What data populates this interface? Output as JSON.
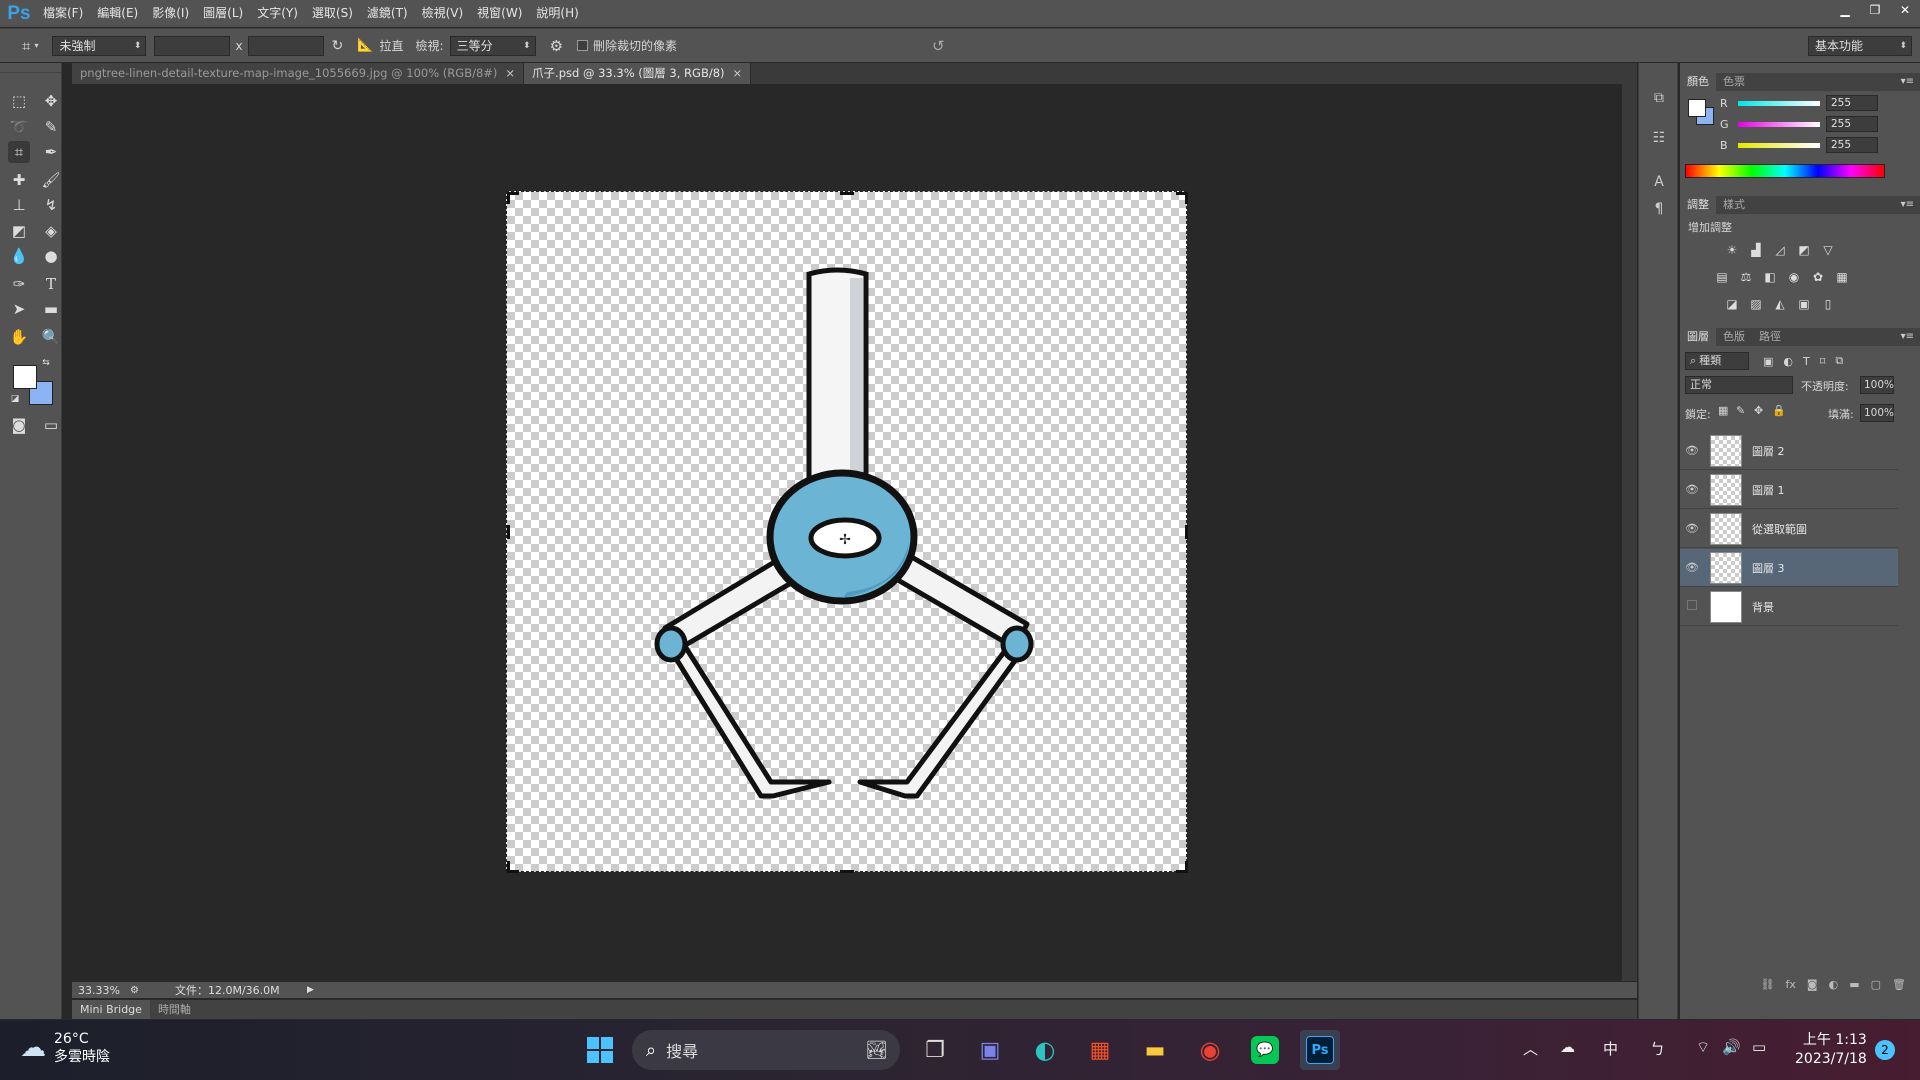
{
  "app": {
    "logo": "Ps"
  },
  "menu": [
    "檔案(F)",
    "編輯(E)",
    "影像(I)",
    "圖層(L)",
    "文字(Y)",
    "選取(S)",
    "濾鏡(T)",
    "檢視(V)",
    "視窗(W)",
    "說明(H)"
  ],
  "window_controls": [
    "minimize-icon",
    "restore-icon",
    "close-icon"
  ],
  "options": {
    "ratio_select": "未強制",
    "x_sep": "x",
    "straighten_label": "拉直",
    "view_label": "檢視:",
    "view_select": "三等分",
    "delete_cropped_label": "刪除裁切的像素",
    "workspace_select": "基本功能"
  },
  "tabs": [
    {
      "label": "pngtree-linen-detail-texture-map-image_1055669.jpg @ 100% (RGB/8#)",
      "close": "×",
      "active": false
    },
    {
      "label": "爪子.psd @ 33.3% (圖層 3, RGB/8)",
      "close": "×",
      "active": true
    }
  ],
  "status": {
    "zoom": "33.33%",
    "doc_info": "文件：12.0M/36.0M"
  },
  "bottom_tabs": [
    "Mini Bridge",
    "時間軸"
  ],
  "color_panel": {
    "tabs": [
      "顏色",
      "色票"
    ],
    "channels": [
      {
        "label": "R",
        "value": "255",
        "color": "#00e5e5"
      },
      {
        "label": "G",
        "value": "255",
        "color": "#e500e5"
      },
      {
        "label": "B",
        "value": "255",
        "color": "#e5e500"
      }
    ]
  },
  "adjust_panel": {
    "tabs": [
      "調整",
      "樣式"
    ],
    "title": "增加調整"
  },
  "layers_panel": {
    "tabs": [
      "圖層",
      "色版",
      "路徑"
    ],
    "filter_select": "種類",
    "blend_mode": "正常",
    "opacity_label": "不透明度:",
    "opacity_value": "100%",
    "lock_label": "鎖定:",
    "fill_label": "填滿:",
    "fill_value": "100%",
    "layers": [
      {
        "name": "圖層 2",
        "visible": true,
        "selected": false
      },
      {
        "name": "圖層 1",
        "visible": true,
        "selected": false
      },
      {
        "name": "從選取範圍",
        "visible": true,
        "selected": false
      },
      {
        "name": "圖層 3",
        "visible": true,
        "selected": true
      },
      {
        "name": "背景",
        "visible": false,
        "selected": false
      }
    ]
  },
  "taskbar": {
    "weather_temp": "26°C",
    "weather_desc": "多雲時陰",
    "search_placeholder": "搜尋",
    "ime_lang": "中",
    "ime_mode": "ㄅ",
    "time": "上午 1:13",
    "date": "2023/7/18",
    "notification_count": "2"
  },
  "colors": {
    "accent": "#3aa2e8",
    "claw_blue": "#6bb4d4",
    "selected_layer": "#586778"
  }
}
